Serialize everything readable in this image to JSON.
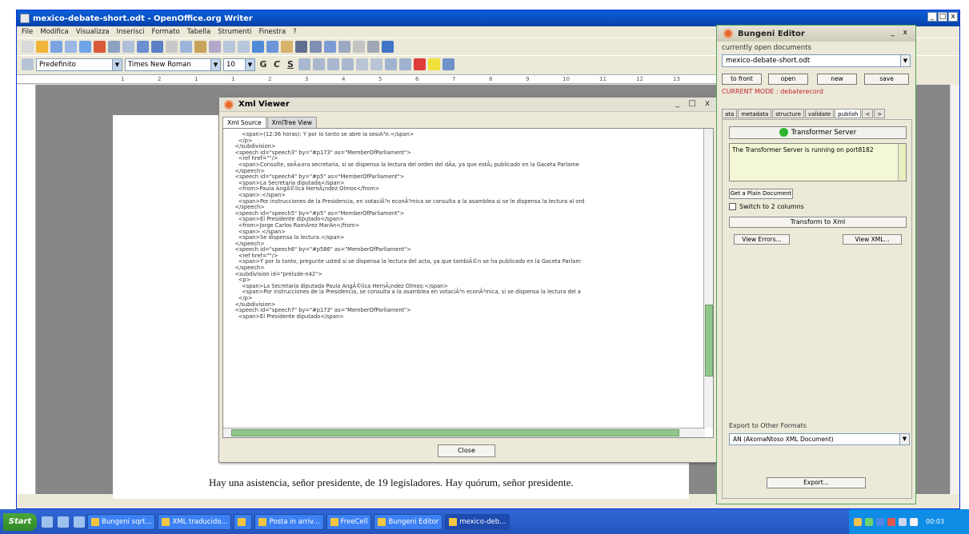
{
  "main_window": {
    "title": "mexico-debate-short.odt - OpenOffice.org Writer",
    "controls": [
      "_",
      "□",
      "x"
    ]
  },
  "menu": [
    "File",
    "Modifica",
    "Visualizza",
    "Inserisci",
    "Formato",
    "Tabella",
    "Strumenti",
    "Finestra",
    "?"
  ],
  "format_bar": {
    "style": "Predefinito",
    "font": "Times New Roman",
    "size": "10"
  },
  "ruler_ticks": [
    "1",
    "2",
    "1",
    "1",
    "2",
    "3",
    "4",
    "5",
    "6",
    "7",
    "8",
    "9",
    "10",
    "11",
    "12",
    "13"
  ],
  "document": {
    "visible_line": "Hay una asistencia, señor presidente, de 19 legisladores. Hay quórum, señor presidente."
  },
  "xml_viewer": {
    "title": "Xml Viewer",
    "controls": "_ □ x",
    "tabs": [
      "Xml Source",
      "XmlTree View"
    ],
    "lines": [
      "        <span>(12:36 horas): Y por lo tanto se abre la sesiÃ³n.</span>",
      "      </p>",
      "    </subdivision>",
      "    <speech id=\"speech3\" by=\"#p173\" as=\"MemberOfParliament\">",
      "      <ref href=\"\"/>",
      "      <span>Consulte, seÃ±ora secretaria, si se dispensa la lectura del orden del dÃ­a, ya que estÃ¡ publicado en la Gaceta Parlame",
      "    </speech>",
      "    <speech id=\"speech4\" by=\"#p5\" as=\"MemberOfParliament\">",
      "      <span>La Secretaria diputada</span>",
      "      <from>Paula AngÃ©lica HernÃ¡ndez Olmos</from>",
      "      <span>:</span>",
      "      <span>Por instrucciones de la Presidencia, en votaciÃ³n econÃ³mica se consulta a la asamblea si se le dispensa la lectura al ord",
      "    </speech>",
      "    <speech id=\"speech5\" by=\"#p5\" as=\"MemberOfParliament\">",
      "      <span>El Presidente diputado</span>",
      "      <from>Jorge Carlos RamÃ­rez MarÃ­n</from>",
      "      <span>:</span>",
      "      <span>Se dispensa la lectura.</span>",
      "    </speech>",
      "    <speech id=\"speech6\" by=\"#p586\" as=\"MemberOfParliament\">",
      "      <ref href=\"\"/>",
      "      <span>Y por lo tanto, pregunte usted si se dispensa la lectura del acta, ya que tambiÃ©n se ha publicado en la Gaceta Parlam",
      "    </speech>",
      "    <subdivision id=\"prelude-n42\">",
      "      <p>",
      "        <span>La Secretaria diputada Paula AngÃ©lica HernÃ¡ndez Olmos:</span>",
      "        <span>Por instrucciones de la Presidencia, se consulta a la asamblea en votaciÃ³n econÃ³mica, si se dispensa la lectura del a",
      "      </p>",
      "    </subdivision>",
      "    <speech id=\"speech7\" by=\"#p173\" as=\"MemberOfParliament\">",
      "      <span>El Presidente diputado</span>"
    ],
    "close_label": "Close"
  },
  "bungeni": {
    "title": "Bungeni Editor",
    "controls": "_ x",
    "open_docs_label": "currently open documents",
    "current_doc": "mexico-debate-short.odt",
    "buttons": [
      "to front",
      "open",
      "new",
      "save"
    ],
    "mode": "CURRENT MODE : debaterecord",
    "tabs": [
      "ata",
      "metadata",
      "structure",
      "validate",
      "publish",
      "<",
      ">"
    ],
    "transformer_button": "Transformer Server",
    "transformer_status": "The Transformer Server is running on port8182",
    "plain_doc_button": "Get a Plain Document",
    "switch_label": "Switch to 2 columns",
    "transform_button": "Transform to Xml",
    "view_errors": "View Errors...",
    "view_xml": "View XML...",
    "export_label": "Export to Other Formats",
    "export_format": "AN (AkomaNtoso XML Document)",
    "export_button": "Export..."
  },
  "taskbar": {
    "start": "Start",
    "tasks": [
      "Bungeni sqrt...",
      "XML traducido...",
      "",
      "Posta in arriv...",
      "FreeCell",
      "Bungeni Editor",
      "mexico-deb..."
    ],
    "clock": "00:03"
  },
  "colors": {
    "title_blue": "#0a5fd8",
    "bungeni_border": "#4fa65a",
    "mode_red": "#c1272d",
    "scroll_green": "#8fc78a",
    "server_green": "#2db52d"
  }
}
